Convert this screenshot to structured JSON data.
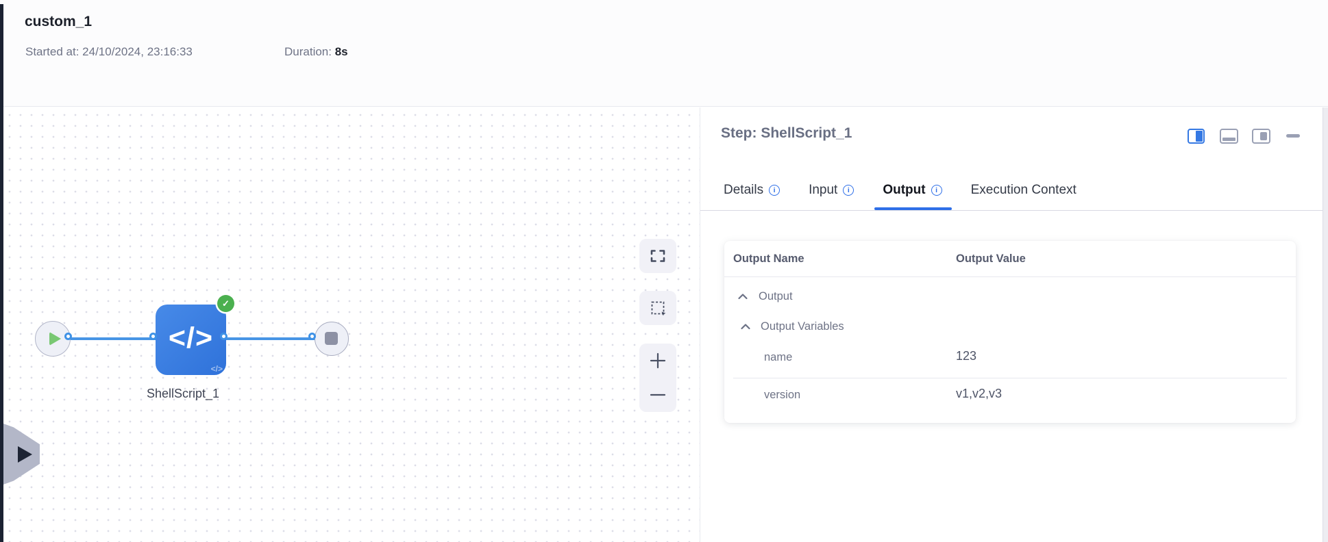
{
  "header": {
    "title": "custom_1",
    "started_label": "Started at:",
    "started_value": "24/10/2024, 23:16:33",
    "duration_label": "Duration:",
    "duration_value": "8s"
  },
  "canvas": {
    "node": {
      "label": "ShellScript_1",
      "icon": "</>",
      "icon_small": "</>",
      "status": "success"
    }
  },
  "icons": {
    "check": "✓",
    "info": "i"
  },
  "panel": {
    "title": "Step: ShellScript_1",
    "tabs": [
      {
        "label": "Details",
        "has_info": true,
        "active": false
      },
      {
        "label": "Input",
        "has_info": true,
        "active": false
      },
      {
        "label": "Output",
        "has_info": true,
        "active": true
      },
      {
        "label": "Execution Context",
        "has_info": false,
        "active": false
      }
    ],
    "table": {
      "columns": [
        "Output Name",
        "Output Value"
      ],
      "rows": [
        {
          "kind": "group",
          "label": "Output",
          "expanded": true
        },
        {
          "kind": "group",
          "label": "Output Variables",
          "expanded": true
        },
        {
          "kind": "variable",
          "label": "name",
          "value": "123"
        },
        {
          "kind": "variable",
          "label": "version",
          "value": "v1,v2,v3"
        }
      ]
    }
  },
  "colors": {
    "accent_blue": "#2e6fe8",
    "node_blue": "#3b80e2",
    "edge_blue": "#4795e5",
    "success_green": "#4bb04f",
    "dark_strip": "#1b2232"
  }
}
